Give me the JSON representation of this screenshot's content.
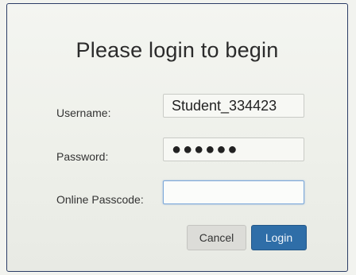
{
  "dialog": {
    "title": "Please login to begin"
  },
  "form": {
    "username_label": "Username:",
    "username_value": "Student_334423",
    "password_label": "Password:",
    "password_value": "●●●●●●",
    "passcode_label": "Online Passcode:",
    "passcode_value": ""
  },
  "buttons": {
    "cancel_label": "Cancel",
    "login_label": "Login"
  },
  "colors": {
    "login_button": "#2f6ea8",
    "cancel_button": "#dcdcd8",
    "frame_border": "#2c3d66"
  }
}
